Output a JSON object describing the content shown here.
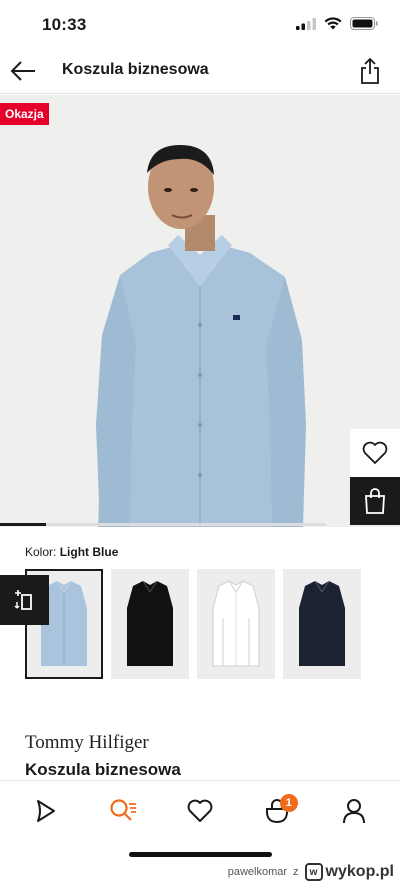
{
  "status": {
    "time": "10:33"
  },
  "header": {
    "title": "Koszula biznesowa"
  },
  "hero": {
    "badge": "Okazja",
    "gallery_progress": 0.14
  },
  "product": {
    "color_prefix": "Kolor:",
    "color_value": "Light Blue",
    "brand": "Tommy Hilfiger",
    "name": "Koszula biznesowa",
    "variants": [
      {
        "color": "#a9c4dc",
        "selected": true
      },
      {
        "color": "#111111",
        "selected": false
      },
      {
        "color": "#ffffff",
        "selected": false
      },
      {
        "color": "#1d2233",
        "selected": false
      }
    ]
  },
  "tabbar": {
    "cart_count": "1"
  },
  "watermark": {
    "user": "pawelkomar",
    "z": "z",
    "site": "wykop.pl"
  },
  "colors": {
    "accent": "#f26a1b",
    "badge_red": "#e4002b",
    "dark": "#1a1a1a"
  },
  "icons": [
    "back-arrow-icon",
    "share-icon",
    "heart-icon",
    "shopping-bag-icon",
    "compare-icon",
    "play-icon",
    "search-icon",
    "cart-icon",
    "profile-icon"
  ]
}
